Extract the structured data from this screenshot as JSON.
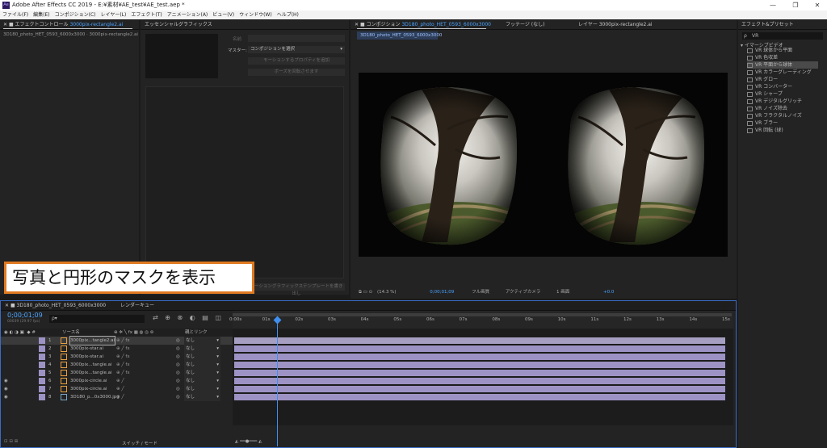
{
  "window": {
    "title": "Adobe After Effects CC 2019 - E:¥素材¥AE_test¥AE_test.aep *",
    "app_icon": "Ae",
    "buttons": [
      "—",
      "❐",
      "✕"
    ]
  },
  "menu": [
    "ファイル(F)",
    "編集(E)",
    "コンポジション(C)",
    "レイヤー(L)",
    "エフェクト(T)",
    "アニメーション(A)",
    "ビュー(V)",
    "ウィンドウ(W)",
    "ヘルプ(H)"
  ],
  "effect_controls": {
    "tab_prefix": "エフェクトコントロール",
    "tab_layer": "3000pix-rectangle2.ai",
    "sub": "3D180_photo_HET_0593_6000x3000 · 3000pix-rectangle2.ai"
  },
  "essential": {
    "tab": "エッセンシャルグラフィックス",
    "name_label": "名前",
    "master_label": "マスター:",
    "master_value": "コンポジションを選択",
    "btn1": "モーションするプロパティを追加",
    "btn2": "ボーズを回転させます",
    "btn_bottom": "モーショングラフィックステンプレートを書き出し"
  },
  "composition": {
    "tab_prefix": "コンポジション",
    "tab_name": "3D180_photo_HET_0593_6000x3000",
    "footage_tab": "フッテージ (なし)",
    "layer_tab": "レイヤー 3000pix-rectangle2.ai",
    "subtab": "3D180_photo_HET_0593_6000x3000",
    "zoom": "(14.3 %)",
    "timecode": "0;00;01;09",
    "resolution": "フル画質",
    "camera": "アクティブカメラ",
    "view": "1 画面",
    "exposure": "+0.0"
  },
  "effects_presets": {
    "tab": "エフェクト&プリセット",
    "search": "VR",
    "category": "イマーシブビデオ",
    "items": [
      "VR 球体から平面",
      "VR 色収差",
      "VR 平面から球体",
      "VR カラーグレーディング",
      "VR グロー",
      "VR コンバーター",
      "VR シャープ",
      "VR デジタルグリッチ",
      "VR ノイズ除去",
      "VR フラクタルノイズ",
      "VR ブラー",
      "VR 回転 (球)"
    ],
    "selected_index": 2
  },
  "caption": "写真と円形のマスクを表示",
  "timeline": {
    "comp_tab": "3D180_photo_HET_0593_6000x3000",
    "render_tab": "レンダーキュー",
    "timecode": "0;00;01;09",
    "frame_info": "00039 (29.97 fps)",
    "search_placeholder": "ρ▾",
    "col_source": "ソース名",
    "col_parent": "親とリンク",
    "switch_mode": "スイッチ / モード",
    "ruler": [
      "0:00s",
      "01s",
      "02s",
      "03s",
      "04s",
      "05s",
      "06s",
      "07s",
      "08s",
      "09s",
      "10s",
      "11s",
      "12s",
      "13s",
      "14s",
      "15s"
    ],
    "layers": [
      {
        "num": "1",
        "name": "3000pix...tangle2.ai",
        "parent": "なし",
        "eye": false,
        "selected": true
      },
      {
        "num": "2",
        "name": "3000pix-star.ai",
        "parent": "なし",
        "eye": false,
        "selected": false
      },
      {
        "num": "3",
        "name": "3000pix-star.ai",
        "parent": "なし",
        "eye": false,
        "selected": false
      },
      {
        "num": "4",
        "name": "3000pix...tangle.ai",
        "parent": "なし",
        "eye": false,
        "selected": false
      },
      {
        "num": "5",
        "name": "3000pix...tangle.ai",
        "parent": "なし",
        "eye": false,
        "selected": false
      },
      {
        "num": "6",
        "name": "3000pix-circle.ai",
        "parent": "なし",
        "eye": true,
        "selected": false
      },
      {
        "num": "7",
        "name": "3000pix-circle.ai",
        "parent": "なし",
        "eye": true,
        "selected": false
      },
      {
        "num": "8",
        "name": "3D180_p...0x3000.jpg",
        "parent": "なし",
        "eye": true,
        "selected": false
      }
    ],
    "playhead_fraction": 0.087,
    "label_colors": {
      "ai": "#e8a03c",
      "jpg": "#7aa7c7",
      "layer_label": "#9d92c4"
    }
  }
}
